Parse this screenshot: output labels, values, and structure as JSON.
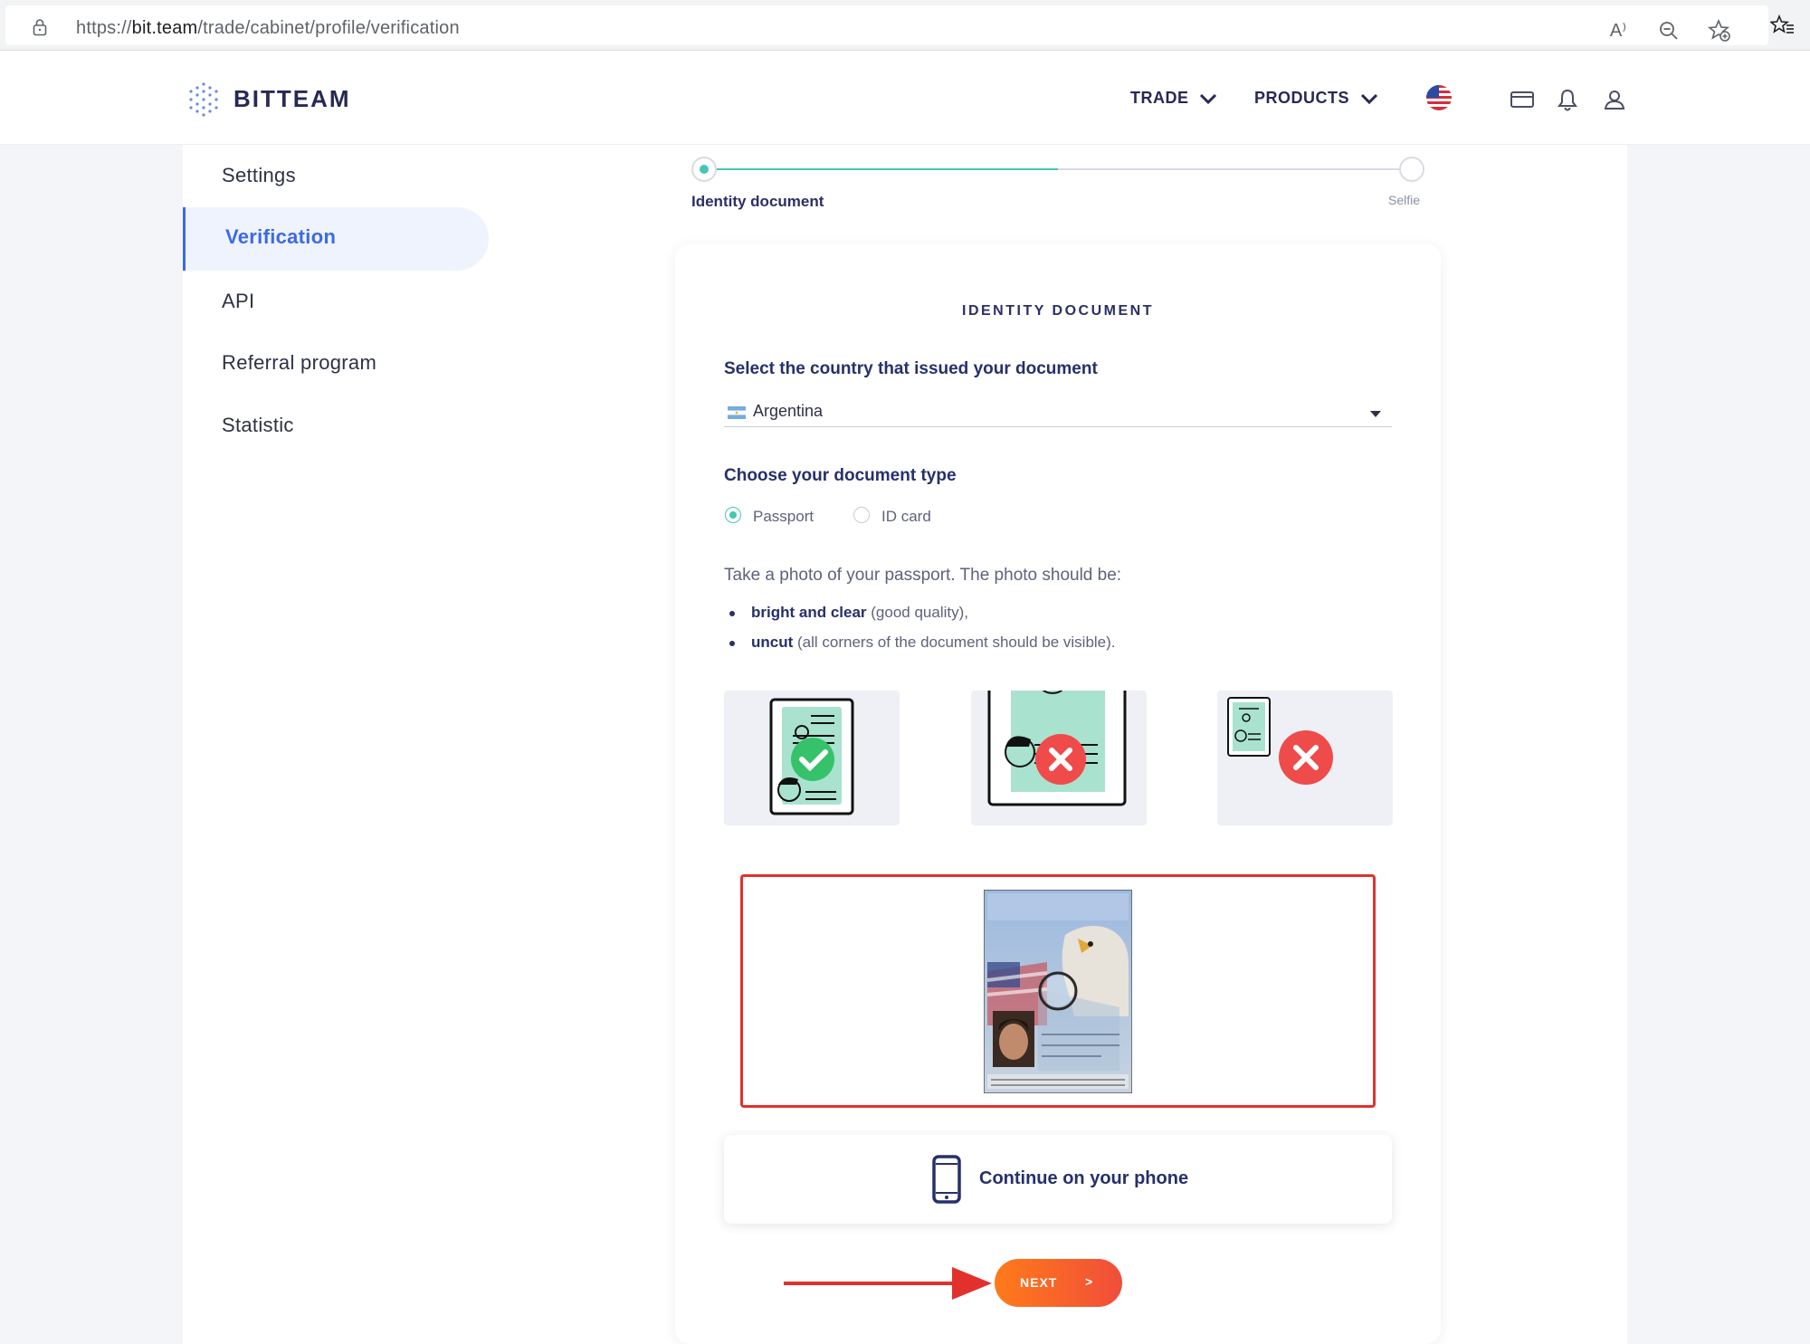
{
  "browser": {
    "url_prefix": "https://",
    "url_domain": "bit.team",
    "url_path": "/trade/cabinet/profile/verification",
    "read_aloud": "A⁾"
  },
  "header": {
    "logo": "BITTEAM",
    "nav": [
      "TRADE",
      "PRODUCTS"
    ]
  },
  "sidebar": {
    "items": [
      "Settings",
      "Verification",
      "API",
      "Referral program",
      "Statistic"
    ],
    "active_index": 1
  },
  "stepper": {
    "steps": [
      "Identity document",
      "Selfie"
    ],
    "progress": 0.5
  },
  "card": {
    "title": "IDENTITY DOCUMENT",
    "country_label": "Select the country that issued your document",
    "country_value": "Argentina",
    "doc_type_label": "Choose your document type",
    "doc_types": [
      "Passport",
      "ID card"
    ],
    "selected_doc_type": "Passport",
    "instructions": "Take a photo of your passport. The photo should be:",
    "bullets": [
      {
        "strong": "bright and clear",
        "rest": " (good quality),"
      },
      {
        "strong": "uncut",
        "rest": " (all corners of the document should be visible)."
      }
    ],
    "phone_label": "Continue on your phone",
    "next_label": "NEXT",
    "next_arrow": ">"
  },
  "colors": {
    "accent": "#46c7b4",
    "primary": "#2b2f66",
    "link": "#3b69e8",
    "highlight": "#e2312d",
    "button_start": "#ff7a1a",
    "button_end": "#f04e3a"
  }
}
